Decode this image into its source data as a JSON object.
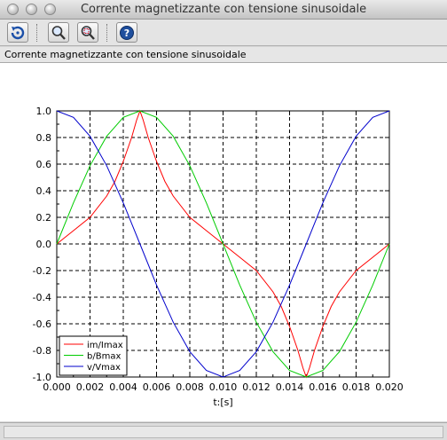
{
  "window": {
    "title": "Corrente magnetizzante con tensione sinusoidale"
  },
  "toolbar": {
    "buttons": [
      {
        "name": "rotate-button",
        "icon": "rotate-icon"
      },
      {
        "name": "zoom-button",
        "icon": "zoom-icon"
      },
      {
        "name": "unzoom-button",
        "icon": "unzoom-icon"
      },
      {
        "name": "help-button",
        "icon": "help-icon"
      }
    ]
  },
  "figure": {
    "title": "Corrente magnetizzante con tensione sinusoidale"
  },
  "chart_data": {
    "type": "line",
    "title": "",
    "xlabel": "t:[s]",
    "ylabel": "",
    "xlim": [
      0,
      0.02
    ],
    "ylim": [
      -1,
      1
    ],
    "xticks": [
      "0.000",
      "0.002",
      "0.004",
      "0.006",
      "0.008",
      "0.010",
      "0.012",
      "0.014",
      "0.016",
      "0.018",
      "0.020"
    ],
    "yticks": [
      "-1.0",
      "-0.8",
      "-0.6",
      "-0.4",
      "-0.2",
      "0.0",
      "0.2",
      "0.4",
      "0.6",
      "0.8",
      "1.0"
    ],
    "grid": true,
    "legend_position": "bottom-left",
    "series": [
      {
        "name": "im/Imax",
        "color": "#ff0000",
        "x": [
          0,
          0.001,
          0.002,
          0.003,
          0.0035,
          0.004,
          0.0045,
          0.0048,
          0.005,
          0.0052,
          0.0055,
          0.006,
          0.0065,
          0.007,
          0.008,
          0.009,
          0.01,
          0.011,
          0.012,
          0.013,
          0.0135,
          0.014,
          0.0145,
          0.0148,
          0.015,
          0.0152,
          0.0155,
          0.016,
          0.0165,
          0.017,
          0.018,
          0.019,
          0.02
        ],
        "y": [
          0,
          0.1,
          0.2,
          0.36,
          0.47,
          0.62,
          0.8,
          0.93,
          1.0,
          0.93,
          0.8,
          0.62,
          0.47,
          0.36,
          0.2,
          0.1,
          0,
          -0.1,
          -0.2,
          -0.36,
          -0.47,
          -0.62,
          -0.8,
          -0.93,
          -1.0,
          -0.93,
          -0.8,
          -0.62,
          -0.47,
          -0.36,
          -0.2,
          -0.1,
          0
        ]
      },
      {
        "name": "b/Bmax",
        "color": "#00cc00",
        "x": [
          0,
          0.001,
          0.002,
          0.003,
          0.004,
          0.005,
          0.006,
          0.007,
          0.008,
          0.009,
          0.01,
          0.011,
          0.012,
          0.013,
          0.014,
          0.015,
          0.016,
          0.017,
          0.018,
          0.019,
          0.02
        ],
        "y": [
          0,
          0.309,
          0.588,
          0.809,
          0.951,
          1.0,
          0.951,
          0.809,
          0.588,
          0.309,
          0,
          -0.309,
          -0.588,
          -0.809,
          -0.951,
          -1.0,
          -0.951,
          -0.809,
          -0.588,
          -0.309,
          0
        ]
      },
      {
        "name": "v/Vmax",
        "color": "#0000cc",
        "x": [
          0,
          0.001,
          0.002,
          0.003,
          0.004,
          0.005,
          0.006,
          0.007,
          0.008,
          0.009,
          0.01,
          0.011,
          0.012,
          0.013,
          0.014,
          0.015,
          0.016,
          0.017,
          0.018,
          0.019,
          0.02
        ],
        "y": [
          1.0,
          0.951,
          0.809,
          0.588,
          0.309,
          0,
          -0.309,
          -0.588,
          -0.809,
          -0.951,
          -1.0,
          -0.951,
          -0.809,
          -0.588,
          -0.309,
          0,
          0.309,
          0.588,
          0.809,
          0.951,
          1.0
        ]
      }
    ]
  }
}
